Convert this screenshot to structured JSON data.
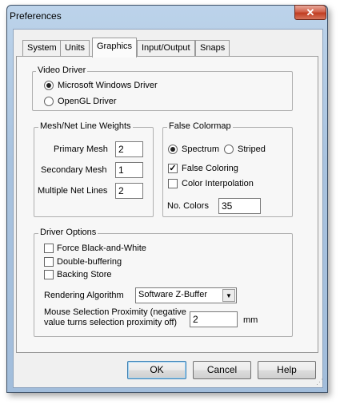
{
  "window": {
    "title": "Preferences",
    "close_glyph": "✕"
  },
  "tabs": [
    {
      "label": "System"
    },
    {
      "label": "Units"
    },
    {
      "label": "Graphics",
      "active": true
    },
    {
      "label": "Input/Output"
    },
    {
      "label": "Snaps"
    }
  ],
  "video_driver": {
    "label": "Video Driver",
    "options": [
      "Microsoft Windows Driver",
      "OpenGL Driver"
    ],
    "selected": "Microsoft Windows Driver"
  },
  "mesh": {
    "label": "Mesh/Net Line Weights",
    "primary_label": "Primary Mesh",
    "primary_value": "2",
    "secondary_label": "Secondary Mesh",
    "secondary_value": "1",
    "multiple_label": "Multiple Net Lines",
    "multiple_value": "2"
  },
  "colormap": {
    "label": "False Colormap",
    "spectrum_label": "Spectrum",
    "striped_label": "Striped",
    "selected": "Spectrum",
    "false_coloring_label": "False Coloring",
    "false_coloring_checked": true,
    "interpolation_label": "Color Interpolation",
    "interpolation_checked": false,
    "num_colors_label": "No. Colors",
    "num_colors_value": "35"
  },
  "driver_options": {
    "label": "Driver Options",
    "bw_label": "Force Black-and-White",
    "bw_checked": false,
    "double_label": "Double-buffering",
    "double_checked": false,
    "backing_label": "Backing Store",
    "backing_checked": false,
    "rendering_label": "Rendering Algorithm",
    "rendering_value": "Software Z-Buffer",
    "proximity_label_line1": "Mouse Selection Proximity (negative",
    "proximity_label_line2": "value turns selection proximity off)",
    "proximity_value": "2",
    "proximity_unit": "mm"
  },
  "buttons": {
    "ok": "OK",
    "cancel": "Cancel",
    "help": "Help"
  },
  "icons": {
    "checkmark": "✓",
    "dropdown_arrow": "▼"
  }
}
